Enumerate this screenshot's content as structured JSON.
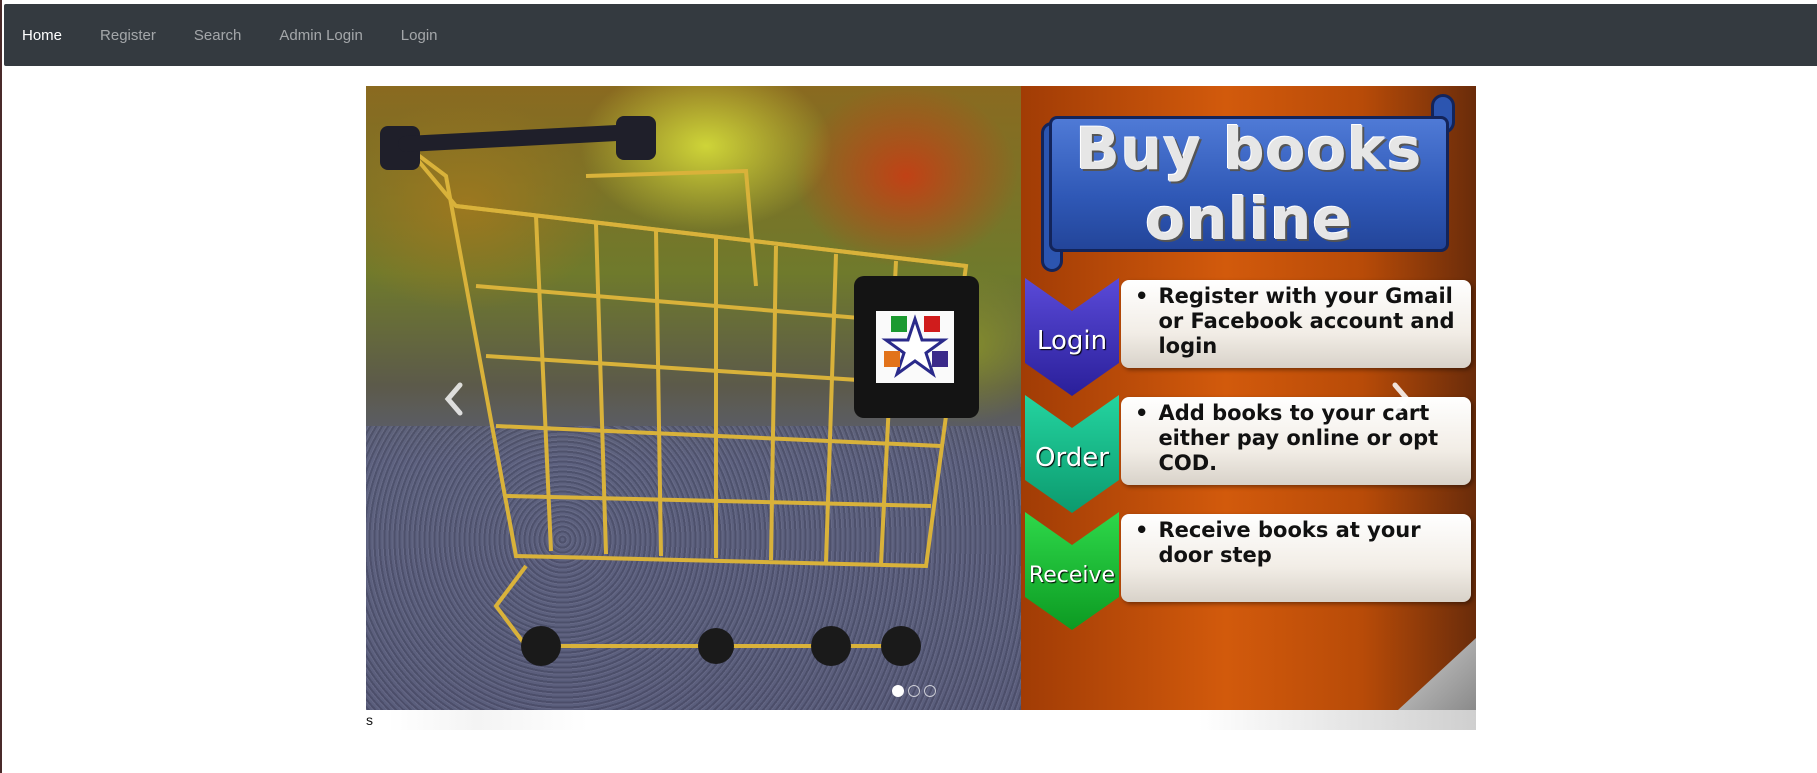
{
  "navbar": {
    "items": [
      {
        "label": "Home",
        "active": true
      },
      {
        "label": "Register",
        "active": false
      },
      {
        "label": "Search",
        "active": false
      },
      {
        "label": "Admin Login",
        "active": false
      },
      {
        "label": "Login",
        "active": false
      }
    ],
    "background_color": "#343a40"
  },
  "carousel": {
    "slide_count": 3,
    "active_slide": 1,
    "prev_icon": "chevron-left-icon",
    "next_icon": "chevron-right-icon",
    "promo": {
      "banner_line1": "Buy books",
      "banner_line2": "online",
      "steps": [
        {
          "badge": "Login",
          "bullet": "•",
          "text": "Register with your Gmail or Facebook account and login",
          "color": "#3a2fc0"
        },
        {
          "badge": "Order",
          "bullet": "•",
          "text": "Add books to your cart either pay online or opt COD.",
          "color": "#12b884"
        },
        {
          "badge": "Receive",
          "bullet": "•",
          "text": "Receive books at your door step",
          "color": "#16b832"
        }
      ]
    },
    "caption": "s"
  }
}
